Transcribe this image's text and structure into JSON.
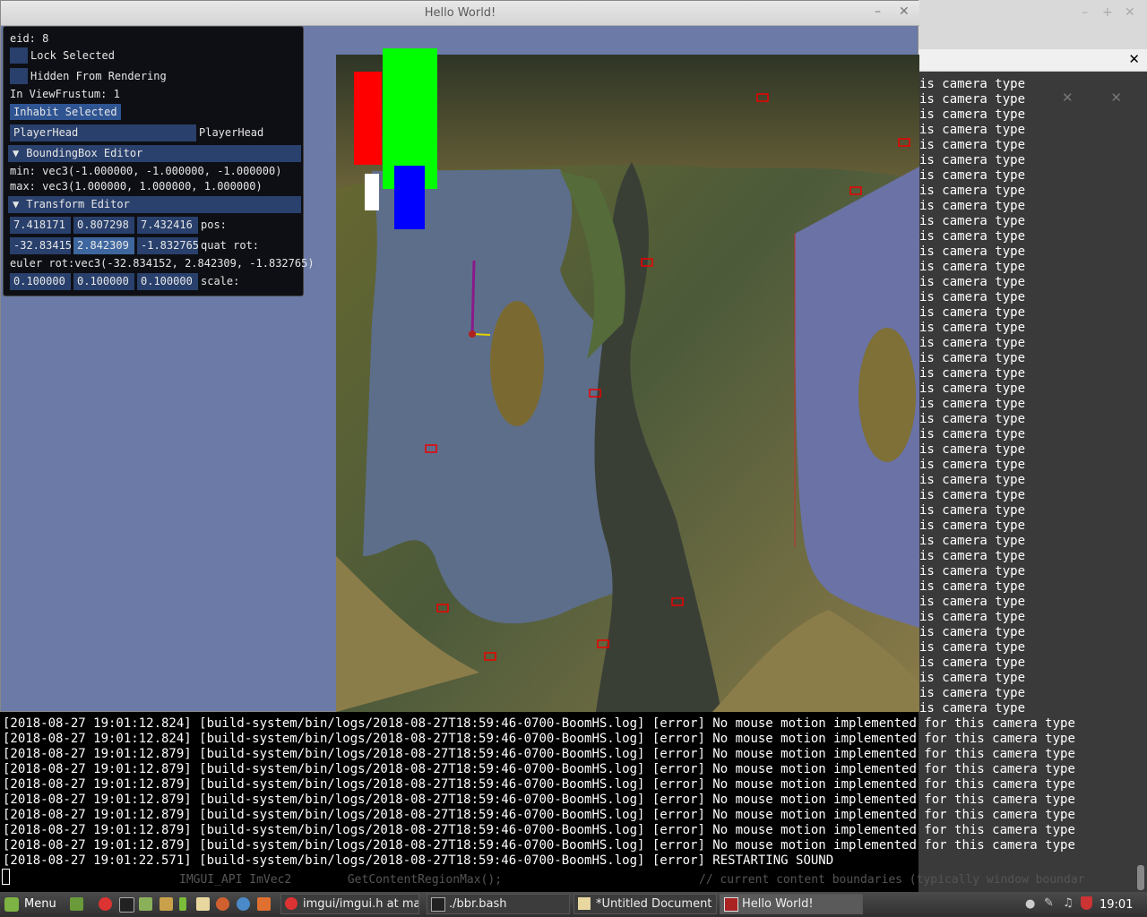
{
  "game_window": {
    "title": "Hello World!",
    "minimize_icon": "–",
    "maximize_icon": "+",
    "close_icon": "✕"
  },
  "imgui": {
    "eid": "eid: 8",
    "lock_selected": "Lock Selected",
    "hidden_from_rendering": "Hidden From Rendering",
    "in_view_frustum": "In ViewFrustum: 1",
    "inhabit_selected": "Inhabit Selected",
    "name_input": "PlayerHead",
    "name_label": "PlayerHead",
    "bbox_header": "BoundingBox Editor",
    "bbox_min": "min: vec3(-1.000000, -1.000000, -1.000000)",
    "bbox_max": "max: vec3(1.000000, 1.000000, 1.000000)",
    "transform_header": "Transform Editor",
    "pos": [
      "7.418171",
      "0.807298",
      "7.432416"
    ],
    "pos_label": "pos:",
    "quat": [
      "-32.83415",
      "2.842309",
      "-1.832765"
    ],
    "quat_label": "quat rot:",
    "euler": "euler rot:vec3(-32.834152, 2.842309, -1.832765)",
    "scale": [
      "0.100000",
      "0.100000",
      "0.100000"
    ],
    "scale_label": "scale:",
    "header_arrow": "▼"
  },
  "terminal": {
    "right_text": "is camera type",
    "log_lines": [
      "[2018-08-27 19:01:12.824] [build-system/bin/logs/2018-08-27T18:59:46-0700-BoomHS.log] [error] No mouse motion implemented for this camera type",
      "[2018-08-27 19:01:12.824] [build-system/bin/logs/2018-08-27T18:59:46-0700-BoomHS.log] [error] No mouse motion implemented for this camera type",
      "[2018-08-27 19:01:12.879] [build-system/bin/logs/2018-08-27T18:59:46-0700-BoomHS.log] [error] No mouse motion implemented for this camera type",
      "[2018-08-27 19:01:12.879] [build-system/bin/logs/2018-08-27T18:59:46-0700-BoomHS.log] [error] No mouse motion implemented for this camera type",
      "[2018-08-27 19:01:12.879] [build-system/bin/logs/2018-08-27T18:59:46-0700-BoomHS.log] [error] No mouse motion implemented for this camera type",
      "[2018-08-27 19:01:12.879] [build-system/bin/logs/2018-08-27T18:59:46-0700-BoomHS.log] [error] No mouse motion implemented for this camera type",
      "[2018-08-27 19:01:12.879] [build-system/bin/logs/2018-08-27T18:59:46-0700-BoomHS.log] [error] No mouse motion implemented for this camera type",
      "[2018-08-27 19:01:12.879] [build-system/bin/logs/2018-08-27T18:59:46-0700-BoomHS.log] [error] No mouse motion implemented for this camera type",
      "[2018-08-27 19:01:12.879] [build-system/bin/logs/2018-08-27T18:59:46-0700-BoomHS.log] [error] No mouse motion implemented for this camera type",
      "[2018-08-27 19:01:22.571] [build-system/bin/logs/2018-08-27T18:59:46-0700-BoomHS.log] [error] RESTARTING SOUND"
    ],
    "ghost_line1": "IMGUI_API ImVec2        GetContentRegionMax();",
    "ghost_line2": "// current content boundaries (typically window boundar"
  },
  "taskbar": {
    "menu_label": "Menu",
    "tasks": [
      {
        "label": "imgui/imgui.h at ma...",
        "icon": "chrome-icon"
      },
      {
        "label": "./bbr.bash",
        "icon": "terminal-icon"
      },
      {
        "label": "*Untitled Document ...",
        "icon": "text-editor-icon"
      },
      {
        "label": "Hello World!",
        "icon": "app-window-icon"
      }
    ],
    "clock": "19:01"
  },
  "colors": {
    "accent_blue": "#29406c",
    "scene_bg": "#6b7aa6",
    "error_red": "#ff0000"
  }
}
